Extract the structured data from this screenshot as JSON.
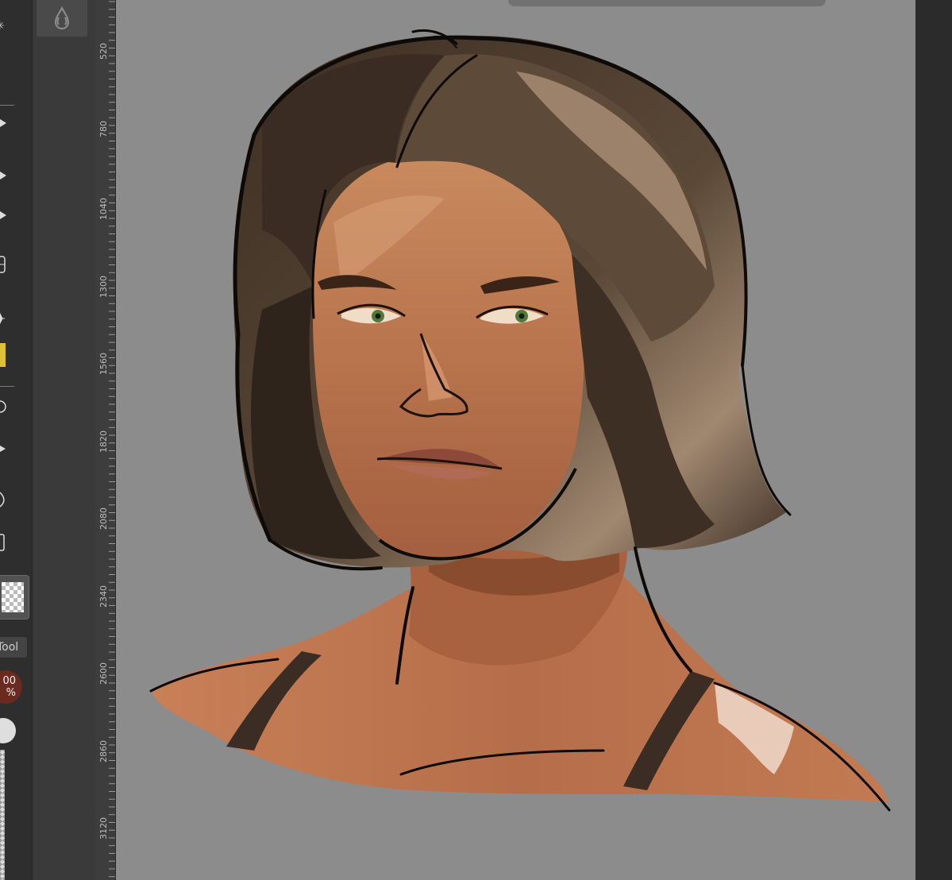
{
  "app": {
    "tools": [
      {
        "name": "sparkle-icon",
        "glyph": "✳"
      },
      {
        "name": "brush-icon",
        "glyph": "◆"
      },
      {
        "name": "pen-icon",
        "glyph": "◆"
      },
      {
        "name": "eraser-icon",
        "glyph": "◆"
      },
      {
        "name": "layers-icon",
        "glyph": "▤"
      },
      {
        "name": "move-icon",
        "glyph": "✦"
      },
      {
        "name": "lasso-icon",
        "glyph": "◎"
      },
      {
        "name": "selection-icon",
        "glyph": "▾"
      },
      {
        "name": "fill-icon",
        "glyph": "◈"
      },
      {
        "name": "crop-icon",
        "glyph": "▯"
      }
    ],
    "panel_button_icon": "drops-icon",
    "tool_label": "Tool",
    "opacity": {
      "line1": "00",
      "line2": "%"
    },
    "colors": {
      "canvas": "#8c8c8c",
      "accent_swatch": "#e0c03a",
      "opacity_badge": "#6b2a1f"
    }
  },
  "ruler": {
    "labels": [
      "520",
      "780",
      "1040",
      "1300",
      "1560",
      "1820",
      "2080",
      "2340",
      "2600",
      "2860",
      "3120"
    ]
  },
  "canvas": {
    "subject": "digital-painting-portrait"
  }
}
